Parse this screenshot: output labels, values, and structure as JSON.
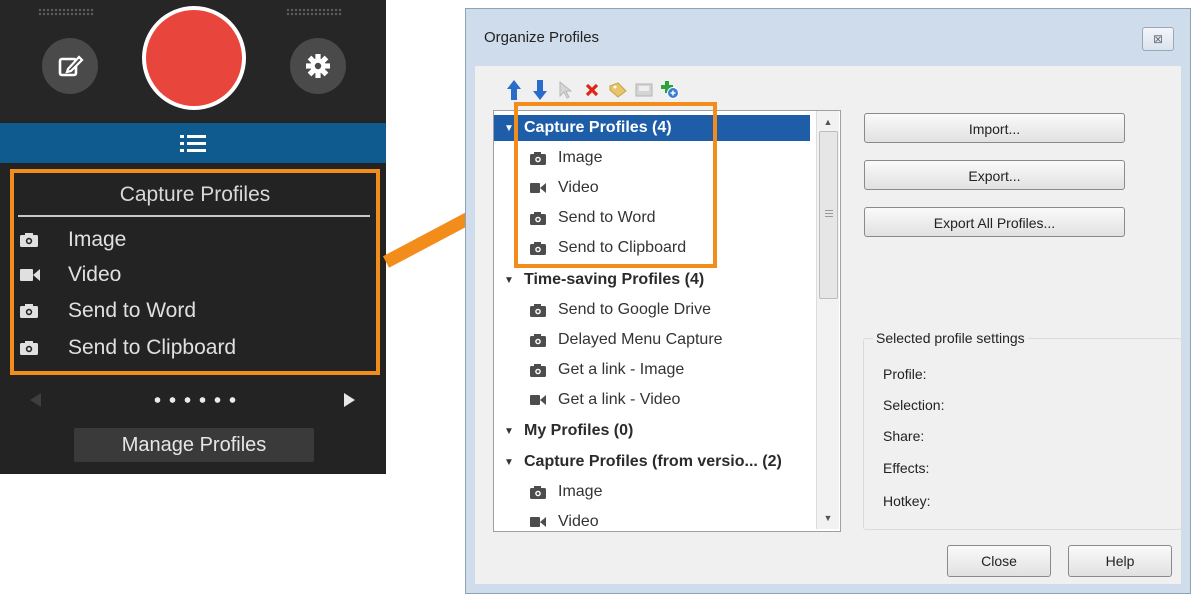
{
  "capture_widget": {
    "icons": {
      "editor": "edit-pencil-icon",
      "record": "record-button",
      "settings": "gear-icon",
      "list": "hamburger-list-icon",
      "prev": "left-arrow-icon",
      "next": "right-arrow-icon"
    },
    "profiles_title": "Capture Profiles",
    "items": [
      {
        "label": "Image",
        "icon": "camera-icon"
      },
      {
        "label": "Video",
        "icon": "video-camera-icon"
      },
      {
        "label": "Send to Word",
        "icon": "camera-icon"
      },
      {
        "label": "Send to Clipboard",
        "icon": "camera-icon"
      }
    ],
    "manage_label": "Manage Profiles"
  },
  "dialog": {
    "title": "Organize Profiles",
    "close_glyph": "⊠",
    "toolbar": [
      {
        "icon": "move-up-icon"
      },
      {
        "icon": "move-down-icon"
      },
      {
        "icon": "cursor-icon"
      },
      {
        "icon": "delete-icon"
      },
      {
        "icon": "tag-icon"
      },
      {
        "icon": "save-icon"
      },
      {
        "icon": "add-profile-icon"
      }
    ],
    "tree": [
      {
        "label": "Capture Profiles (4)",
        "group": true,
        "selected": true
      },
      {
        "label": "Image",
        "icon": "camera-icon"
      },
      {
        "label": "Video",
        "icon": "video-camera-icon"
      },
      {
        "label": "Send to Word",
        "icon": "camera-icon"
      },
      {
        "label": "Send to Clipboard",
        "icon": "camera-icon"
      },
      {
        "label": "Time-saving Profiles (4)",
        "group": true
      },
      {
        "label": "Send to Google Drive",
        "icon": "camera-icon"
      },
      {
        "label": "Delayed Menu Capture",
        "icon": "camera-icon"
      },
      {
        "label": "Get a link - Image",
        "icon": "camera-icon"
      },
      {
        "label": "Get a link - Video",
        "icon": "video-camera-icon"
      },
      {
        "label": "My Profiles (0)",
        "group": true
      },
      {
        "label": "Capture Profiles (from versio... (2)",
        "group": true
      },
      {
        "label": "Image",
        "icon": "camera-icon"
      },
      {
        "label": "Video",
        "icon": "video-camera-icon"
      }
    ],
    "buttons": {
      "import": "Import...",
      "export": "Export...",
      "export_all": "Export All Profiles...",
      "close": "Close",
      "help": "Help"
    },
    "settings": {
      "title": "Selected profile settings",
      "labels": [
        "Profile:",
        "Selection:",
        "Share:",
        "Effects:",
        "Hotkey:"
      ]
    }
  },
  "colors": {
    "accent_orange": "#f28c1a",
    "record_red": "#e8453c",
    "selection_blue": "#1e5ea8",
    "widget_bar_blue": "#0f5a8f"
  }
}
